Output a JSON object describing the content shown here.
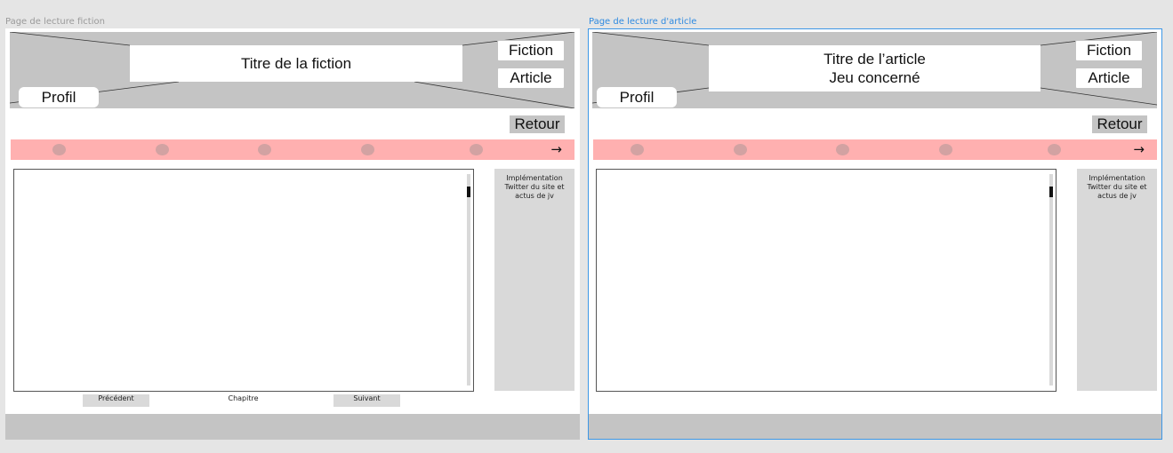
{
  "frames": {
    "fiction": {
      "label": "Page de lecture fiction",
      "title_line1": "Titre de la fiction",
      "nav_fiction": "Fiction",
      "nav_article": "Article",
      "profil": "Profil",
      "retour": "Retour",
      "arrow": "→",
      "side_line1": "Implémentation",
      "side_line2": "Twitter du site et",
      "side_line3": "actus de jv",
      "prev": "Précédent",
      "chapter": "Chapitre",
      "next": "Suivant"
    },
    "article": {
      "label": "Page de lecture d'article",
      "title_line1": "Titre de l’article",
      "title_line2": "Jeu concerné",
      "nav_fiction": "Fiction",
      "nav_article": "Article",
      "profil": "Profil",
      "retour": "Retour",
      "arrow": "→",
      "side_line1": "Implémentation",
      "side_line2": "Twitter du site et",
      "side_line3": "actus de jv"
    }
  },
  "colors": {
    "canvas": "#e5e5e5",
    "placeholder_gray": "#c4c4c4",
    "progress_pink": "#ffb0b0",
    "selection_blue": "#3d97e6"
  },
  "icons": {
    "next": "arrow-right-icon"
  }
}
